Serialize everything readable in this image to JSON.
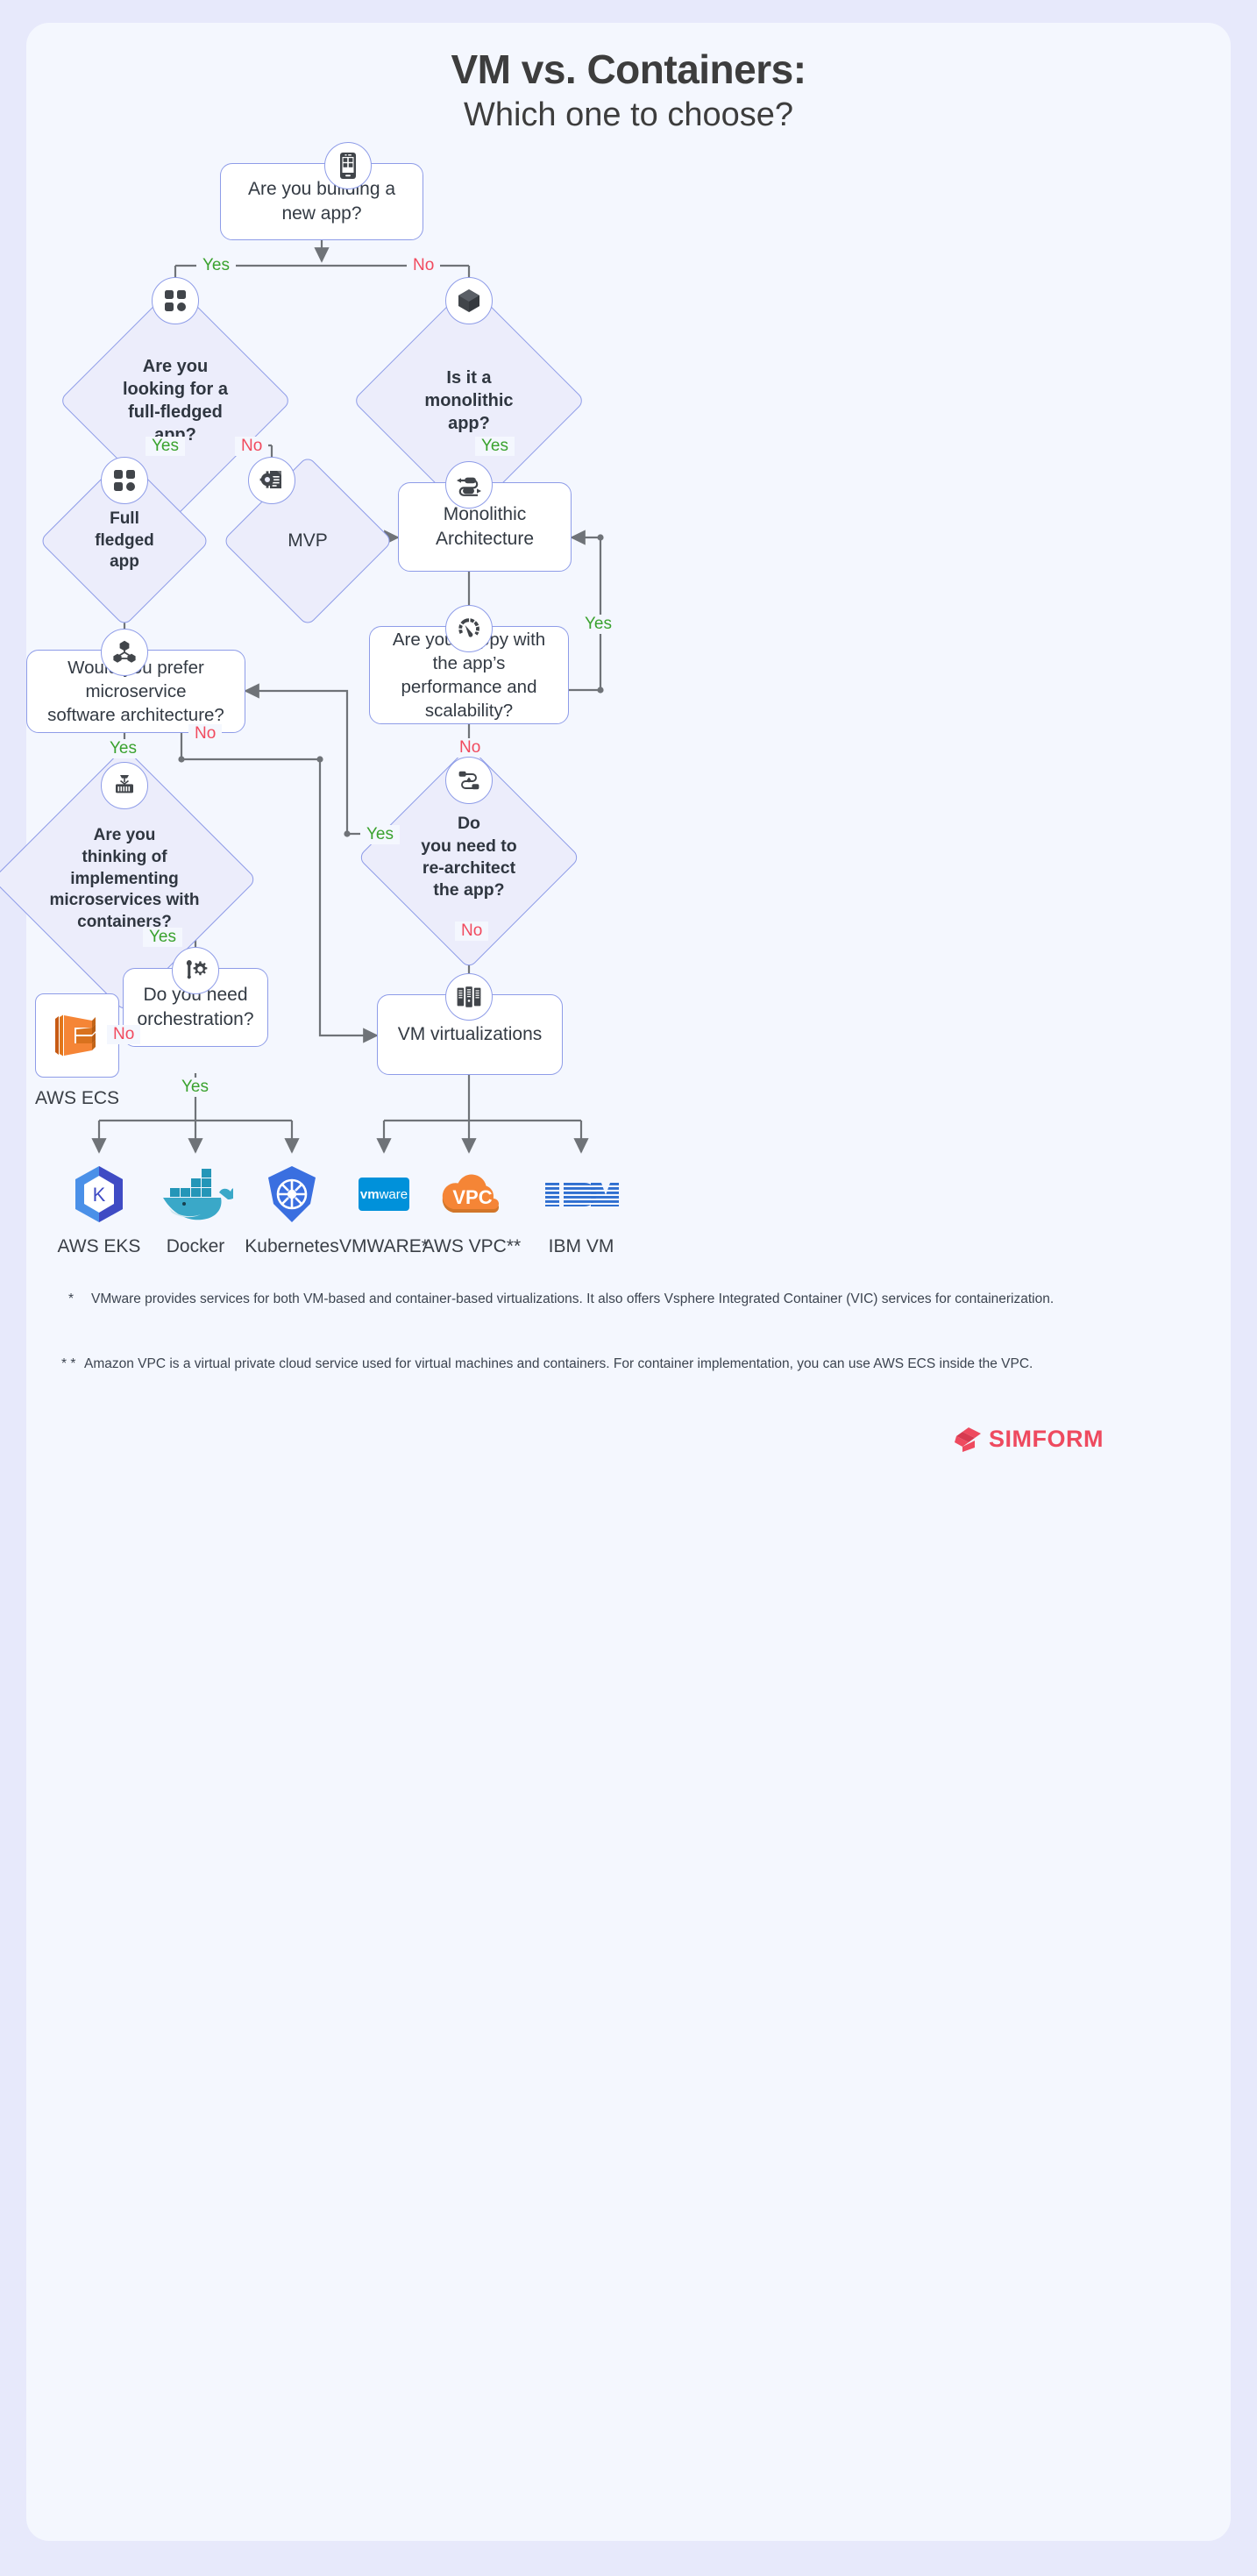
{
  "header": {
    "title": "VM vs. Containers:",
    "subtitle": "Which one to choose?"
  },
  "nodes": {
    "new_app": {
      "label": "Are you building a\nnew app?",
      "icon": "mobile-app-icon"
    },
    "full_fledged_q": {
      "label": "Are you\nlooking for a\nfull-fledged\napp?",
      "icon": "grid-squares-icon"
    },
    "monolithic_q": {
      "label": "Is it a\nmonolithic\napp?",
      "icon": "cube-icon"
    },
    "full_fledged_app": {
      "label": "Full\nfledged\napp",
      "icon": "grid-squares-icon"
    },
    "mvp": {
      "label": "MVP",
      "icon": "gear-document-icon"
    },
    "monolithic_arch": {
      "label": "Monolithic\nArchitecture",
      "icon": "pipeline-icon"
    },
    "happy_perf_q": {
      "label": "Are you happy with the app’s\nperformance and scalability?",
      "icon": "speedometer-icon"
    },
    "microservice_q": {
      "label": "Would you prefer microservice\nsoftware architecture?",
      "icon": "microservices-nodes-icon"
    },
    "containers_q": {
      "label": "Are you\nthinking of\nimplementing\nmicroservices with\ncontainers?",
      "icon": "shipping-container-icon"
    },
    "rearchitect_q": {
      "label": "Do\nyou need to\nre-architect\nthe app?",
      "icon": "refactor-flow-icon"
    },
    "orchestration_q": {
      "label": "Do you need\norchestration?",
      "icon": "wrench-gear-icon"
    },
    "vm_virtualizations": {
      "label": "VM virtualizations",
      "icon": "servers-icon"
    }
  },
  "edge_labels": {
    "root_yes": "Yes",
    "root_no": "No",
    "fullfledged_yes": "Yes",
    "fullfledged_no": "No",
    "monolithic_yes": "Yes",
    "happy_yes": "Yes",
    "happy_no": "No",
    "microservice_yes": "Yes",
    "microservice_no": "No",
    "containers_yes": "Yes",
    "rearchitect_yes": "Yes",
    "rearchitect_no": "No",
    "orchestration_no": "No",
    "orchestration_yes": "Yes"
  },
  "ecs": {
    "label": "AWS ECS",
    "icon": "aws-ecs-logo"
  },
  "container_tech": [
    {
      "label": "AWS EKS",
      "icon": "aws-eks-logo"
    },
    {
      "label": "Docker",
      "icon": "docker-logo"
    },
    {
      "label": "Kubernetes",
      "icon": "kubernetes-logo"
    }
  ],
  "vm_tech": [
    {
      "label": "VMWARE*",
      "icon": "vmware-logo"
    },
    {
      "label": "AWS VPC**",
      "icon": "aws-vpc-logo"
    },
    {
      "label": "IBM VM",
      "icon": "ibm-logo"
    }
  ],
  "footnotes": [
    {
      "mark": "*",
      "text": "VMware provides services for both VM-based and container-based virtualizations. It also offers Vsphere Integrated Container (VIC) services for containerization."
    },
    {
      "mark": "* *",
      "text": "Amazon VPC is a virtual private cloud service used for virtual machines and containers. For container implementation, you can use AWS ECS inside the VPC."
    }
  ],
  "brand": {
    "name": "SIMFORM",
    "color": "#ee4a5f"
  },
  "colors": {
    "page_bg": "#e7e9fb",
    "canvas_bg": "#f4f7fe",
    "node_border": "#8e9ce8",
    "diamond_fill": "#ecedfb",
    "yes": "#3aa22e",
    "no": "#f14a5e",
    "wire": "#6f7378",
    "text": "#333a43"
  }
}
